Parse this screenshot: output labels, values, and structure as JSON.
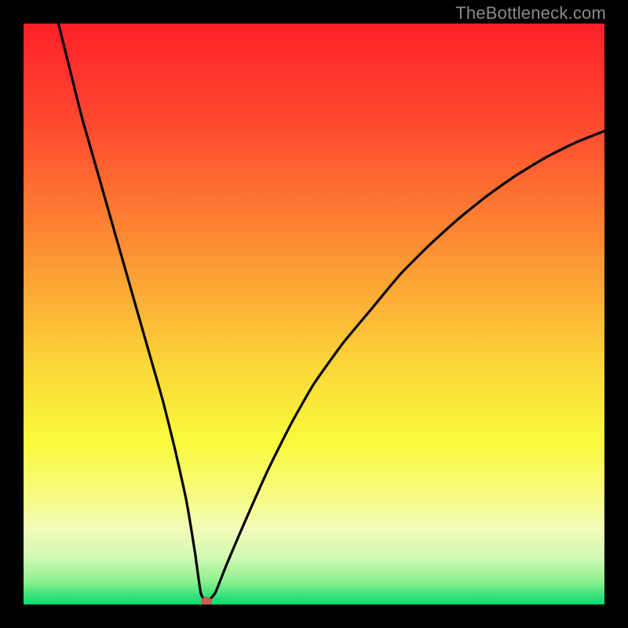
{
  "watermark": "TheBottleneck.com",
  "chart_data": {
    "type": "line",
    "title": "",
    "xlabel": "",
    "ylabel": "",
    "xlim": [
      0,
      100
    ],
    "ylim": [
      0,
      100
    ],
    "grid": false,
    "legend": false,
    "axis_ticks_shown": false,
    "series": [
      {
        "name": "bottleneck_curve",
        "x": [
          6,
          8,
          10,
          12,
          14,
          16,
          18,
          20,
          22,
          24,
          26,
          28,
          29.5,
          30.5,
          31.5,
          33,
          35,
          38,
          42,
          46,
          50,
          55,
          60,
          65,
          70,
          75,
          80,
          85,
          90,
          95,
          100
        ],
        "y": [
          100,
          92,
          84,
          77,
          70,
          63,
          56,
          49,
          42,
          35,
          27,
          18,
          9,
          2,
          0.5,
          2,
          7,
          14,
          23,
          31,
          38,
          45,
          51,
          57,
          62,
          66.5,
          70.5,
          74,
          77,
          79.5,
          81.5
        ]
      }
    ],
    "marker": {
      "x": 31.5,
      "y": 0.5,
      "color": "#cc5b52"
    },
    "background_gradient": [
      {
        "stop": 0.0,
        "color": "#fd2029"
      },
      {
        "stop": 0.18,
        "color": "#fe4b2f"
      },
      {
        "stop": 0.38,
        "color": "#fd8d33"
      },
      {
        "stop": 0.58,
        "color": "#fbd438"
      },
      {
        "stop": 0.72,
        "color": "#fafa3c"
      },
      {
        "stop": 0.8,
        "color": "#f8fb77"
      },
      {
        "stop": 0.87,
        "color": "#f2fcb9"
      },
      {
        "stop": 0.92,
        "color": "#d0f9b3"
      },
      {
        "stop": 0.96,
        "color": "#8ff08f"
      },
      {
        "stop": 0.985,
        "color": "#38e27a"
      },
      {
        "stop": 1.0,
        "color": "#09dd72"
      }
    ]
  }
}
